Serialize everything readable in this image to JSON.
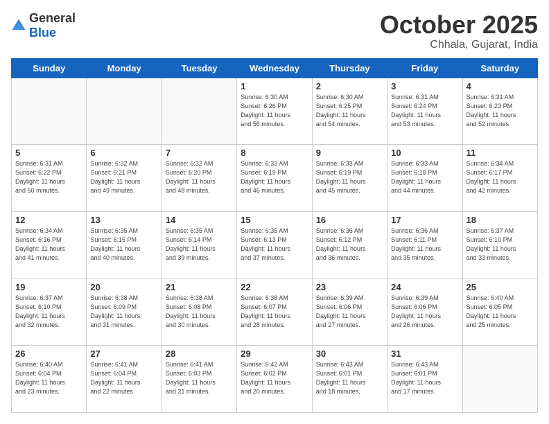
{
  "logo": {
    "general": "General",
    "blue": "Blue"
  },
  "header": {
    "month": "October 2025",
    "location": "Chhala, Gujarat, India"
  },
  "weekdays": [
    "Sunday",
    "Monday",
    "Tuesday",
    "Wednesday",
    "Thursday",
    "Friday",
    "Saturday"
  ],
  "weeks": [
    [
      {
        "day": "",
        "info": ""
      },
      {
        "day": "",
        "info": ""
      },
      {
        "day": "",
        "info": ""
      },
      {
        "day": "1",
        "info": "Sunrise: 6:30 AM\nSunset: 6:26 PM\nDaylight: 11 hours\nand 56 minutes."
      },
      {
        "day": "2",
        "info": "Sunrise: 6:30 AM\nSunset: 6:25 PM\nDaylight: 11 hours\nand 54 minutes."
      },
      {
        "day": "3",
        "info": "Sunrise: 6:31 AM\nSunset: 6:24 PM\nDaylight: 11 hours\nand 53 minutes."
      },
      {
        "day": "4",
        "info": "Sunrise: 6:31 AM\nSunset: 6:23 PM\nDaylight: 11 hours\nand 52 minutes."
      }
    ],
    [
      {
        "day": "5",
        "info": "Sunrise: 6:31 AM\nSunset: 6:22 PM\nDaylight: 11 hours\nand 50 minutes."
      },
      {
        "day": "6",
        "info": "Sunrise: 6:32 AM\nSunset: 6:21 PM\nDaylight: 11 hours\nand 49 minutes."
      },
      {
        "day": "7",
        "info": "Sunrise: 6:32 AM\nSunset: 6:20 PM\nDaylight: 11 hours\nand 48 minutes."
      },
      {
        "day": "8",
        "info": "Sunrise: 6:33 AM\nSunset: 6:19 PM\nDaylight: 11 hours\nand 46 minutes."
      },
      {
        "day": "9",
        "info": "Sunrise: 6:33 AM\nSunset: 6:19 PM\nDaylight: 11 hours\nand 45 minutes."
      },
      {
        "day": "10",
        "info": "Sunrise: 6:33 AM\nSunset: 6:18 PM\nDaylight: 11 hours\nand 44 minutes."
      },
      {
        "day": "11",
        "info": "Sunrise: 6:34 AM\nSunset: 6:17 PM\nDaylight: 11 hours\nand 42 minutes."
      }
    ],
    [
      {
        "day": "12",
        "info": "Sunrise: 6:34 AM\nSunset: 6:16 PM\nDaylight: 11 hours\nand 41 minutes."
      },
      {
        "day": "13",
        "info": "Sunrise: 6:35 AM\nSunset: 6:15 PM\nDaylight: 11 hours\nand 40 minutes."
      },
      {
        "day": "14",
        "info": "Sunrise: 6:35 AM\nSunset: 6:14 PM\nDaylight: 11 hours\nand 39 minutes."
      },
      {
        "day": "15",
        "info": "Sunrise: 6:35 AM\nSunset: 6:13 PM\nDaylight: 11 hours\nand 37 minutes."
      },
      {
        "day": "16",
        "info": "Sunrise: 6:36 AM\nSunset: 6:12 PM\nDaylight: 11 hours\nand 36 minutes."
      },
      {
        "day": "17",
        "info": "Sunrise: 6:36 AM\nSunset: 6:11 PM\nDaylight: 11 hours\nand 35 minutes."
      },
      {
        "day": "18",
        "info": "Sunrise: 6:37 AM\nSunset: 6:10 PM\nDaylight: 11 hours\nand 33 minutes."
      }
    ],
    [
      {
        "day": "19",
        "info": "Sunrise: 6:37 AM\nSunset: 6:10 PM\nDaylight: 11 hours\nand 32 minutes."
      },
      {
        "day": "20",
        "info": "Sunrise: 6:38 AM\nSunset: 6:09 PM\nDaylight: 11 hours\nand 31 minutes."
      },
      {
        "day": "21",
        "info": "Sunrise: 6:38 AM\nSunset: 6:08 PM\nDaylight: 11 hours\nand 30 minutes."
      },
      {
        "day": "22",
        "info": "Sunrise: 6:38 AM\nSunset: 6:07 PM\nDaylight: 11 hours\nand 28 minutes."
      },
      {
        "day": "23",
        "info": "Sunrise: 6:39 AM\nSunset: 6:06 PM\nDaylight: 11 hours\nand 27 minutes."
      },
      {
        "day": "24",
        "info": "Sunrise: 6:39 AM\nSunset: 6:06 PM\nDaylight: 11 hours\nand 26 minutes."
      },
      {
        "day": "25",
        "info": "Sunrise: 6:40 AM\nSunset: 6:05 PM\nDaylight: 11 hours\nand 25 minutes."
      }
    ],
    [
      {
        "day": "26",
        "info": "Sunrise: 6:40 AM\nSunset: 6:04 PM\nDaylight: 11 hours\nand 23 minutes."
      },
      {
        "day": "27",
        "info": "Sunrise: 6:41 AM\nSunset: 6:04 PM\nDaylight: 11 hours\nand 22 minutes."
      },
      {
        "day": "28",
        "info": "Sunrise: 6:41 AM\nSunset: 6:03 PM\nDaylight: 11 hours\nand 21 minutes."
      },
      {
        "day": "29",
        "info": "Sunrise: 6:42 AM\nSunset: 6:02 PM\nDaylight: 11 hours\nand 20 minutes."
      },
      {
        "day": "30",
        "info": "Sunrise: 6:43 AM\nSunset: 6:01 PM\nDaylight: 11 hours\nand 18 minutes."
      },
      {
        "day": "31",
        "info": "Sunrise: 6:43 AM\nSunset: 6:01 PM\nDaylight: 11 hours\nand 17 minutes."
      },
      {
        "day": "",
        "info": ""
      }
    ]
  ]
}
